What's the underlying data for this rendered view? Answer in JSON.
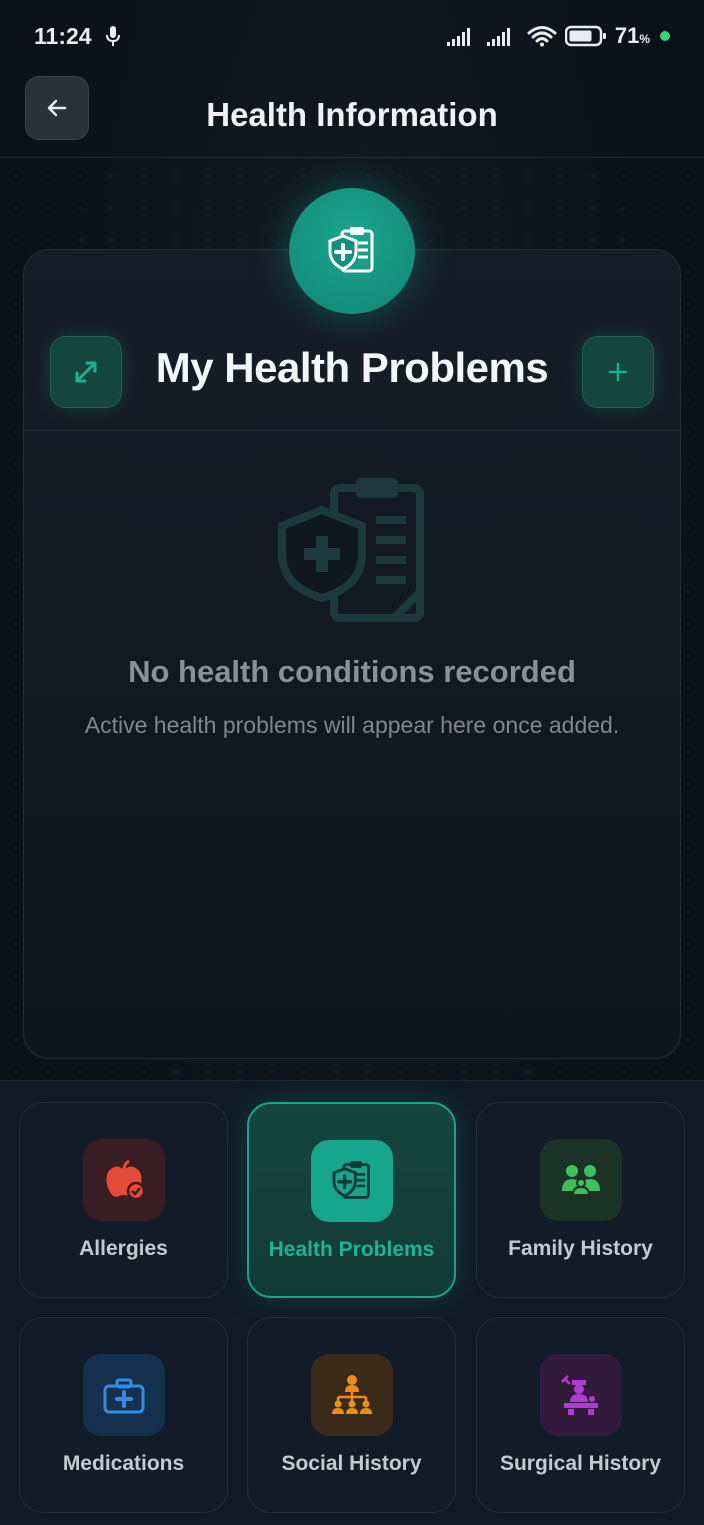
{
  "status_bar": {
    "time": "11:24",
    "battery_percent": "71",
    "battery_unit": "%"
  },
  "header": {
    "title": "Health Information",
    "back_icon": "arrow-left-icon"
  },
  "card": {
    "title": "My Health Problems",
    "hero_icon": "clipboard-shield-icon",
    "expand_icon": "expand-icon",
    "add_icon": "plus-icon",
    "empty_icon": "clipboard-shield-icon",
    "empty_title": "No health conditions recorded",
    "empty_subtitle": "Active health problems will appear here once added."
  },
  "nav_tiles": [
    {
      "label": "Allergies",
      "icon": "apple-icon",
      "color": "#e64a3b",
      "active": false
    },
    {
      "label": "Health Problems",
      "icon": "clipboard-shield-icon",
      "color": "#20b296",
      "active": true
    },
    {
      "label": "Family History",
      "icon": "family-icon",
      "color": "#3fbf5e",
      "active": false
    },
    {
      "label": "Medications",
      "icon": "medkit-icon",
      "color": "#2f8de4",
      "active": false
    },
    {
      "label": "Social History",
      "icon": "social-network-icon",
      "color": "#f08c1a",
      "active": false
    },
    {
      "label": "Surgical History",
      "icon": "surgeon-icon",
      "color": "#b13bd0",
      "active": false
    }
  ],
  "colors": {
    "accent": "#1aa58d",
    "background": "#0b1119"
  }
}
